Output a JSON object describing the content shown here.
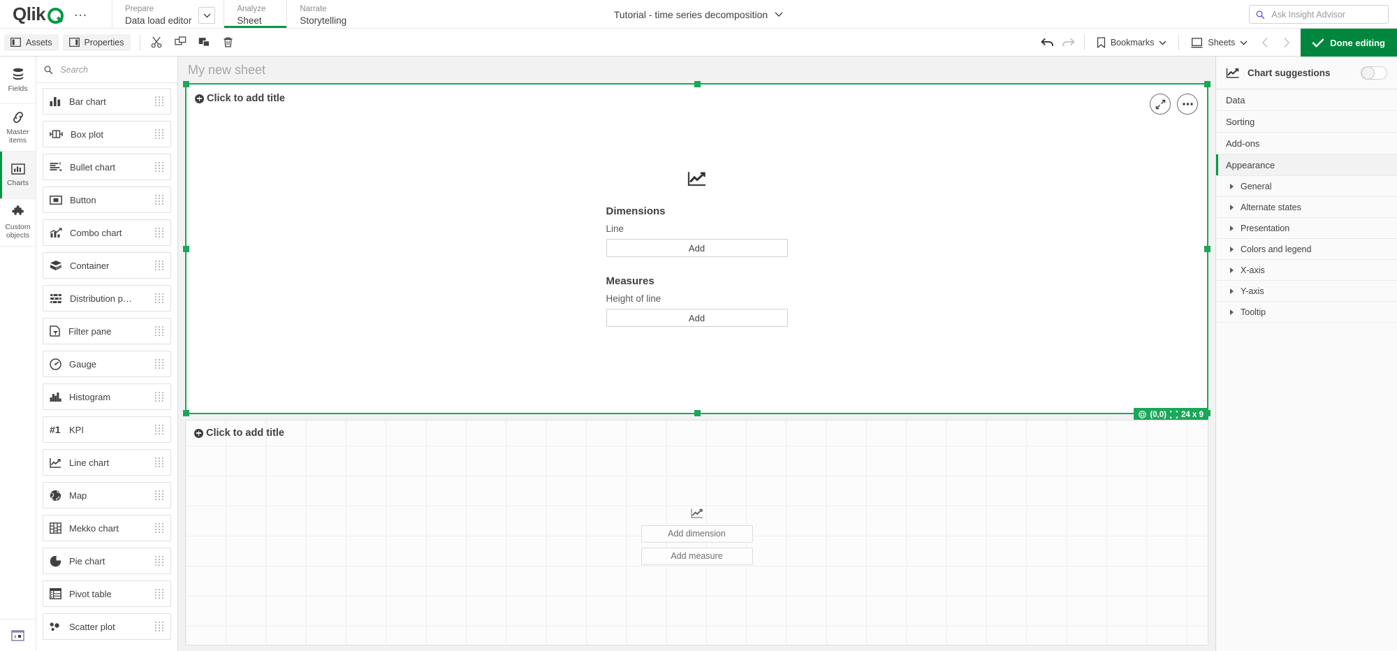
{
  "header": {
    "logo_text": "Qlik",
    "more_menu": "…",
    "nav": [
      {
        "small": "Prepare",
        "main": "Data load editor",
        "active": false,
        "has_dropdown": true
      },
      {
        "small": "Analyze",
        "main": "Sheet",
        "active": true,
        "has_dropdown": false
      },
      {
        "small": "Narrate",
        "main": "Storytelling",
        "active": false,
        "has_dropdown": false
      }
    ],
    "app_title": "Tutorial - time series decomposition",
    "search": {
      "placeholder": "Ask Insight Advisor",
      "value": ""
    }
  },
  "toolbar": {
    "left": [
      {
        "label": "Assets",
        "icon": "panel-left-icon"
      },
      {
        "label": "Properties",
        "icon": "panel-right-icon"
      }
    ],
    "icon_buttons": [
      {
        "name": "cut-icon",
        "title": "Cut"
      },
      {
        "name": "copy-icon",
        "title": "Copy"
      },
      {
        "name": "paste-icon",
        "title": "Paste"
      },
      {
        "name": "delete-icon",
        "title": "Delete"
      }
    ],
    "undo": "Undo",
    "redo": "Redo",
    "bookmarks_label": "Bookmarks",
    "sheets_label": "Sheets",
    "prev_sheet": "Previous sheet",
    "next_sheet": "Next sheet",
    "done_editing_label": "Done editing"
  },
  "rail": {
    "items": [
      {
        "label": "Fields",
        "icon": "database-icon",
        "active": false
      },
      {
        "label": "Master items",
        "icon": "link-icon",
        "active": false
      },
      {
        "label": "Charts",
        "icon": "bar-chart-icon",
        "active": true
      },
      {
        "label": "Custom objects",
        "icon": "puzzle-icon",
        "active": false
      }
    ],
    "bottom_icon": "dev-tools-icon"
  },
  "assets": {
    "search": {
      "placeholder": "Search",
      "value": ""
    },
    "items": [
      {
        "label": "Bar chart",
        "icon": "bar-chart-icon"
      },
      {
        "label": "Box plot",
        "icon": "box-plot-icon"
      },
      {
        "label": "Bullet chart",
        "icon": "bullet-chart-icon"
      },
      {
        "label": "Button",
        "icon": "button-icon"
      },
      {
        "label": "Combo chart",
        "icon": "combo-chart-icon"
      },
      {
        "label": "Container",
        "icon": "container-icon"
      },
      {
        "label": "Distribution p…",
        "icon": "distribution-plot-icon"
      },
      {
        "label": "Filter pane",
        "icon": "filter-pane-icon"
      },
      {
        "label": "Gauge",
        "icon": "gauge-icon"
      },
      {
        "label": "Histogram",
        "icon": "histogram-icon"
      },
      {
        "label": "KPI",
        "icon": "kpi-icon"
      },
      {
        "label": "Line chart",
        "icon": "line-chart-icon"
      },
      {
        "label": "Map",
        "icon": "map-icon"
      },
      {
        "label": "Mekko chart",
        "icon": "mekko-chart-icon"
      },
      {
        "label": "Pie chart",
        "icon": "pie-chart-icon"
      },
      {
        "label": "Pivot table",
        "icon": "pivot-table-icon"
      },
      {
        "label": "Scatter plot",
        "icon": "scatter-plot-icon"
      }
    ]
  },
  "sheet": {
    "title": "My new sheet",
    "selected_object": {
      "title_placeholder": "Click to add title",
      "chart_icon": "line-chart-icon",
      "dimensions_heading": "Dimensions",
      "dimension_name": "Line",
      "dimension_add_label": "Add",
      "measures_heading": "Measures",
      "measure_name": "Height of line",
      "measure_add_label": "Add",
      "expand_button": "fullscreen-icon",
      "menu_button": "more-options-icon",
      "position_badge": "(0,0)",
      "size_badge": "24 x 9"
    },
    "second_object": {
      "title_placeholder": "Click to add title",
      "chart_icon": "line-chart-icon",
      "add_dimension_label": "Add dimension",
      "add_measure_label": "Add measure"
    }
  },
  "properties": {
    "suggestions_label": "Chart suggestions",
    "suggestions_icon": "line-chart-icon",
    "suggestions_on": false,
    "sections": [
      {
        "label": "Data",
        "active": false
      },
      {
        "label": "Sorting",
        "active": false
      },
      {
        "label": "Add-ons",
        "active": false
      },
      {
        "label": "Appearance",
        "active": true
      }
    ],
    "subsections": [
      {
        "label": "General"
      },
      {
        "label": "Alternate states"
      },
      {
        "label": "Presentation"
      },
      {
        "label": "Colors and legend"
      },
      {
        "label": "X-axis"
      },
      {
        "label": "Y-axis"
      },
      {
        "label": "Tooltip"
      }
    ]
  },
  "colors": {
    "brand_green": "#009845",
    "selection_green": "#1aa75a",
    "done_green": "#00873d",
    "canvas_bg": "#f2f2f2",
    "text": "#404040"
  }
}
